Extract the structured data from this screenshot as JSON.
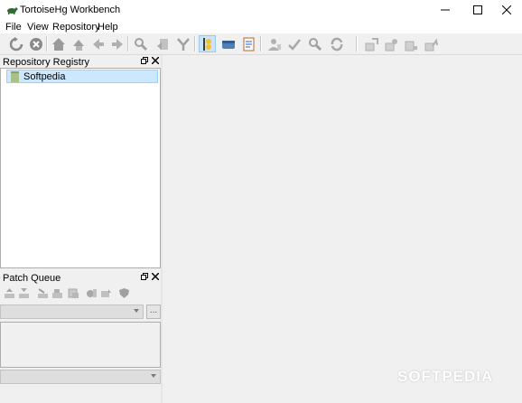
{
  "window": {
    "title": "TortoiseHg Workbench"
  },
  "menu": [
    "File",
    "View",
    "Repository",
    "Help"
  ],
  "toolbar_icons": [
    "refresh-icon",
    "stop-icon",
    "home-icon",
    "history-icon",
    "back-icon",
    "forward-icon",
    "search-icon",
    "pull-icon",
    "merge-icon",
    "revision-details-icon",
    "commit-icon",
    "manifest-icon",
    "user-icon",
    "check-icon",
    "find-icon",
    "sync-icon",
    "incoming-icon",
    "pull-repo-icon",
    "outgoing-icon",
    "push-icon"
  ],
  "repo_registry": {
    "title": "Repository Registry",
    "items": [
      {
        "label": "Softpedia",
        "selected": true
      }
    ]
  },
  "patch_queue": {
    "title": "Patch Queue",
    "combo_value": "",
    "dots_label": "...",
    "bottom_combo_value": ""
  },
  "watermark": "SOFTPEDIA",
  "colors": {
    "selection_bg": "#cce8ff",
    "active_tool_bg": "#cce4f7",
    "chrome": "#f0f0f0"
  }
}
